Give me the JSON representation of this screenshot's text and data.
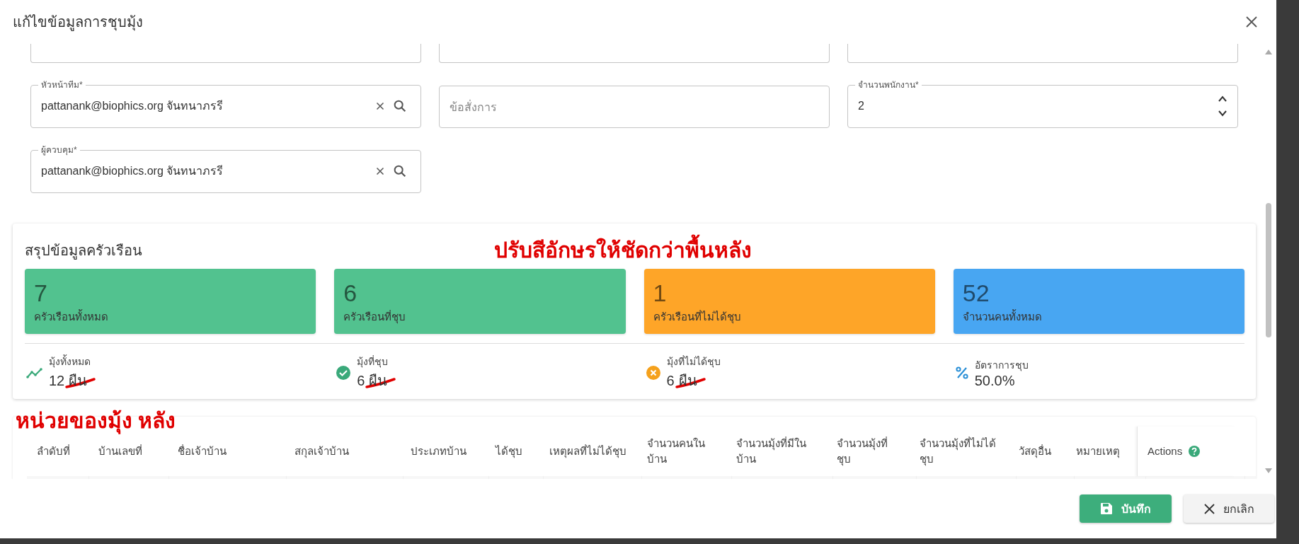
{
  "dialog": {
    "title": "แก้ไขข้อมูลการชุบมุ้ง"
  },
  "fields": [
    {
      "kind": "lookup",
      "label": "หัวหน้าทีม*",
      "value": "pattanank@biophics.org จันทนาภรรี"
    },
    {
      "kind": "text",
      "placeholder": "ข้อสั่งการ"
    },
    {
      "kind": "number",
      "label": "จำนวนพนักงาน*",
      "value": "2"
    },
    {
      "kind": "lookup",
      "label": "ผู้ควบคุม*",
      "value": "pattanank@biophics.org จันทนาภรรี"
    }
  ],
  "summary": {
    "title": "สรุปข้อมูลครัวเรือน",
    "cards": [
      {
        "value": "7",
        "label": "ครัวเรือนทั้งหมด",
        "color": "#52c28f"
      },
      {
        "value": "6",
        "label": "ครัวเรือนที่ชุบ",
        "color": "#52c28f"
      },
      {
        "value": "1",
        "label": "ครัวเรือนที่ไม่ได้ชุบ",
        "color": "#fea528"
      },
      {
        "value": "52",
        "label": "จำนวนคนทั้งหมด",
        "color": "#48a6f2"
      }
    ],
    "stats": [
      {
        "kind": "trend",
        "label": "มุ้งทั้งหมด",
        "value": "12",
        "unit": "ผืน",
        "struck": true
      },
      {
        "kind": "check",
        "label": "มุ้งที่ชุบ",
        "value": "6",
        "unit": "ผืน",
        "struck": true
      },
      {
        "kind": "cancel",
        "label": "มุ้งที่ไม่ได้ชุบ",
        "value": "6",
        "unit": "ผืน",
        "struck": true
      },
      {
        "kind": "percent",
        "label": "อัตราการชุบ",
        "value": "50.0%"
      }
    ]
  },
  "annotations": [
    "ปรับสีอักษรให้ชัดกว่าพื้นหลัง",
    "หน่วยของมุ้ง หลัง"
  ],
  "table": {
    "columns": [
      "ลำดับที่",
      "บ้านเลขที่",
      "ชื่อเจ้าบ้าน",
      "สกุลเจ้าบ้าน",
      "ประเภทบ้าน",
      "ได้ชุบ",
      "เหตุผลที่ไม่ได้ชุบ",
      "จำนวนคนในบ้าน",
      "จำนวนมุ้งที่มีในบ้าน",
      "จำนวนมุ้งที่ชุบ",
      "จำนวนมุ้งที่ไม่ได้ชุบ",
      "วัสดุอื่น",
      "หมายเหตุ",
      "Actions"
    ]
  },
  "buttons": [
    {
      "kind": "save",
      "label": "บันทึก"
    },
    {
      "kind": "cancel",
      "label": "ยกเลิก"
    }
  ]
}
